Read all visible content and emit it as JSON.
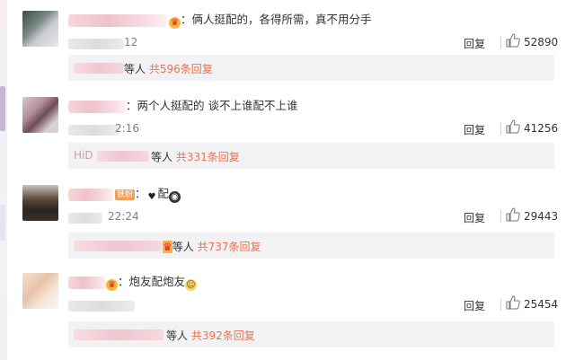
{
  "colors": {
    "link": "#eb7350",
    "text": "#333333",
    "muted": "#808080",
    "subbg": "#f2f2f5"
  },
  "comments": [
    {
      "text": "：俩人挺配的，各得所需，真不用分手",
      "time": "12",
      "reply": "回复",
      "likes": "52890",
      "sub": {
        "mid": "等人",
        "count": "共596条回复"
      }
    },
    {
      "text": "：两个人挺配的 谈不上谁配不上谁",
      "time": "2:16",
      "reply": "回复",
      "likes": "41256",
      "sub": {
        "prefix": "HiD",
        "mid": "等人",
        "count": "共331条回复"
      }
    },
    {
      "badge": "铁粉",
      "text": "：",
      "text2": "配",
      "time": "22:24",
      "reply": "回复",
      "likes": "29443",
      "sub": {
        "mid": "等人",
        "count": "共737条回复"
      }
    },
    {
      "text": "：炮友配炮友",
      "time": "",
      "reply": "回复",
      "likes": "25454",
      "sub": {
        "mid": "等人",
        "count": "共392条回复"
      }
    }
  ],
  "icons": [
    "thumbs-up-icon",
    "vip-crown-icon",
    "heart-icon",
    "dog-emoji-icon",
    "smirk-emoji-icon"
  ]
}
